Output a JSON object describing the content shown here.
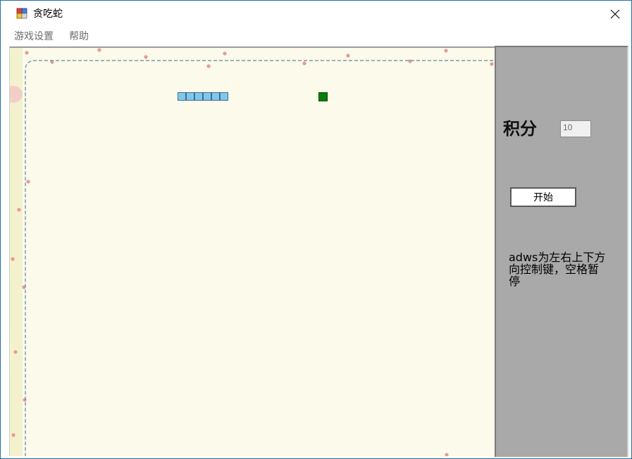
{
  "window": {
    "title": "贪吃蛇",
    "close_icon": "close-icon",
    "app_icon": "app-icon"
  },
  "menu": {
    "items": [
      {
        "label": "游戏设置"
      },
      {
        "label": "帮助"
      }
    ]
  },
  "board": {
    "snake_segments": 6,
    "snake_color": "#82c7e9",
    "food_color": "#0a7d0a",
    "background_color": "#fbfaeb",
    "border_dash_color": "#5a8a99"
  },
  "side_panel": {
    "score_label": "积分",
    "score_value": "10",
    "start_button_label": "开始",
    "help_text": "adws为左右上下方向控制键，空格暂停",
    "background_color": "#a9a9a9"
  }
}
